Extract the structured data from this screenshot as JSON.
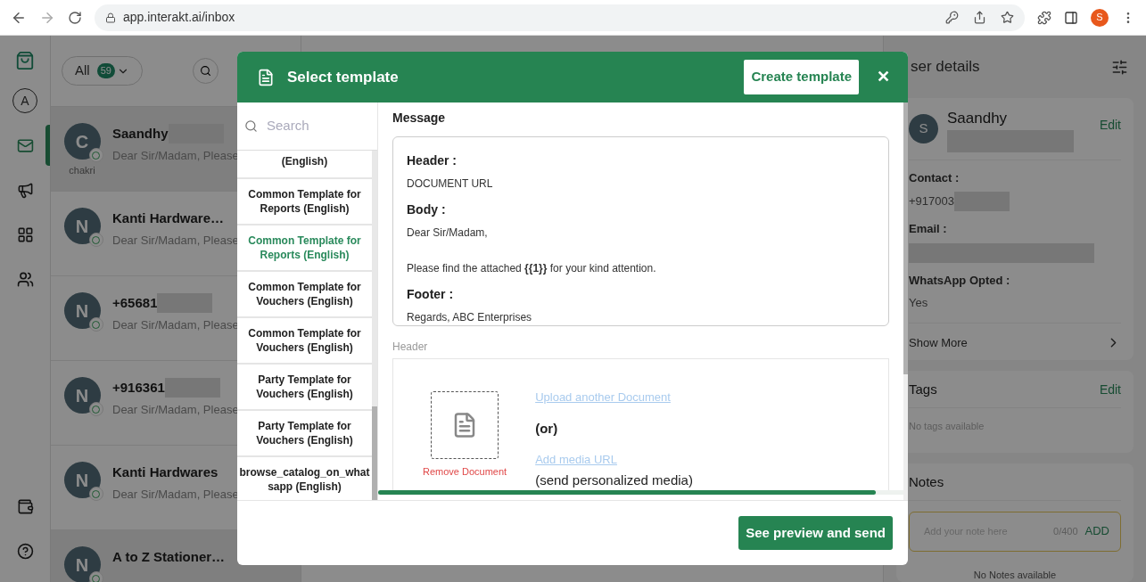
{
  "browser": {
    "url": "app.interakt.ai/inbox",
    "avatar": "S"
  },
  "nav_items": [
    {
      "kind": "profile",
      "label": "A",
      "selected": false
    },
    {
      "kind": "inbox",
      "selected": true
    },
    {
      "kind": "campaigns",
      "selected": false
    },
    {
      "kind": "apps",
      "selected": false
    },
    {
      "kind": "contacts",
      "selected": false
    }
  ],
  "nav_bottom": [
    {
      "kind": "wallet"
    },
    {
      "kind": "help"
    }
  ],
  "filter": {
    "label": "All",
    "count": "59"
  },
  "conversations": [
    {
      "name": "Saandhy",
      "redacted": true,
      "preview": "Dear Sir/Madam, Please",
      "avatar": "C",
      "caption": "chakri",
      "selected": true
    },
    {
      "name": "Kanti Hardware…",
      "redacted": false,
      "preview": "Dear Sir/Madam, Please",
      "avatar": "N",
      "selected": false
    },
    {
      "name": "+65681",
      "redacted": true,
      "preview": "Dear Sir/Madam, Please",
      "avatar": "N",
      "selected": false
    },
    {
      "name": "+916361",
      "redacted": true,
      "preview": "Dear Sir/Madam, Please",
      "avatar": "N",
      "selected": false
    },
    {
      "name": "Kanti Hardwares",
      "redacted": false,
      "preview": "Dear Sir/Madam, Please",
      "avatar": "N",
      "selected": false
    },
    {
      "name": "A to Z Stationer…",
      "redacted": false,
      "avatar": "N",
      "selected": true
    }
  ],
  "modal": {
    "title": "Select template",
    "create_button": "Create template",
    "close": "✕",
    "search": {
      "placeholder": "Search"
    },
    "templates": [
      {
        "label": "(English)",
        "selected": false
      },
      {
        "label": "Common Template for Reports (English)",
        "selected": false
      },
      {
        "label": "Common Template for Reports (English)",
        "selected": true
      },
      {
        "label": "Common Template for Vouchers (English)",
        "selected": false
      },
      {
        "label": "Common Template for Vouchers (English)",
        "selected": false
      },
      {
        "label": "Party Template for Vouchers (English)",
        "selected": false
      },
      {
        "label": "Party Template for Vouchers (English)",
        "selected": false
      },
      {
        "label": "browse_catalog_on_whatsapp (English)",
        "selected": false
      }
    ],
    "message": {
      "title": "Message",
      "sections": [
        {
          "label": "Header :",
          "lines": [
            "DOCUMENT URL"
          ]
        },
        {
          "label": "Body :",
          "lines": [
            "Dear Sir/Madam,",
            "Please find the attached **{{1}}** for your kind attention."
          ]
        },
        {
          "label": "Footer :",
          "lines": [
            "Regards, ABC Enterprises"
          ]
        }
      ]
    },
    "header_input": {
      "label": "Header",
      "remove": "Remove Document",
      "upload_link": "Upload another Document",
      "or": "(or)",
      "media_link": "Add media URL",
      "media_note": "(send personalized media)"
    },
    "send_button": "See preview and send"
  },
  "user_panel": {
    "title": "ser details",
    "name": "Saandhy",
    "avatar": "S",
    "edit": "Edit",
    "fields": [
      {
        "label": "Contact :",
        "value": "+917003",
        "redacted": true
      },
      {
        "label": "Email :",
        "redacted": true
      },
      {
        "label": "WhatsApp Opted :",
        "value": "Yes",
        "redacted": false
      }
    ],
    "show_more": "Show More",
    "tags": {
      "title": "Tags",
      "edit": "Edit",
      "empty": "No tags available"
    },
    "notes": {
      "title": "Notes",
      "placeholder": "Add your note here",
      "counter": "0/400",
      "add": "ADD",
      "empty": "No Notes available"
    }
  }
}
